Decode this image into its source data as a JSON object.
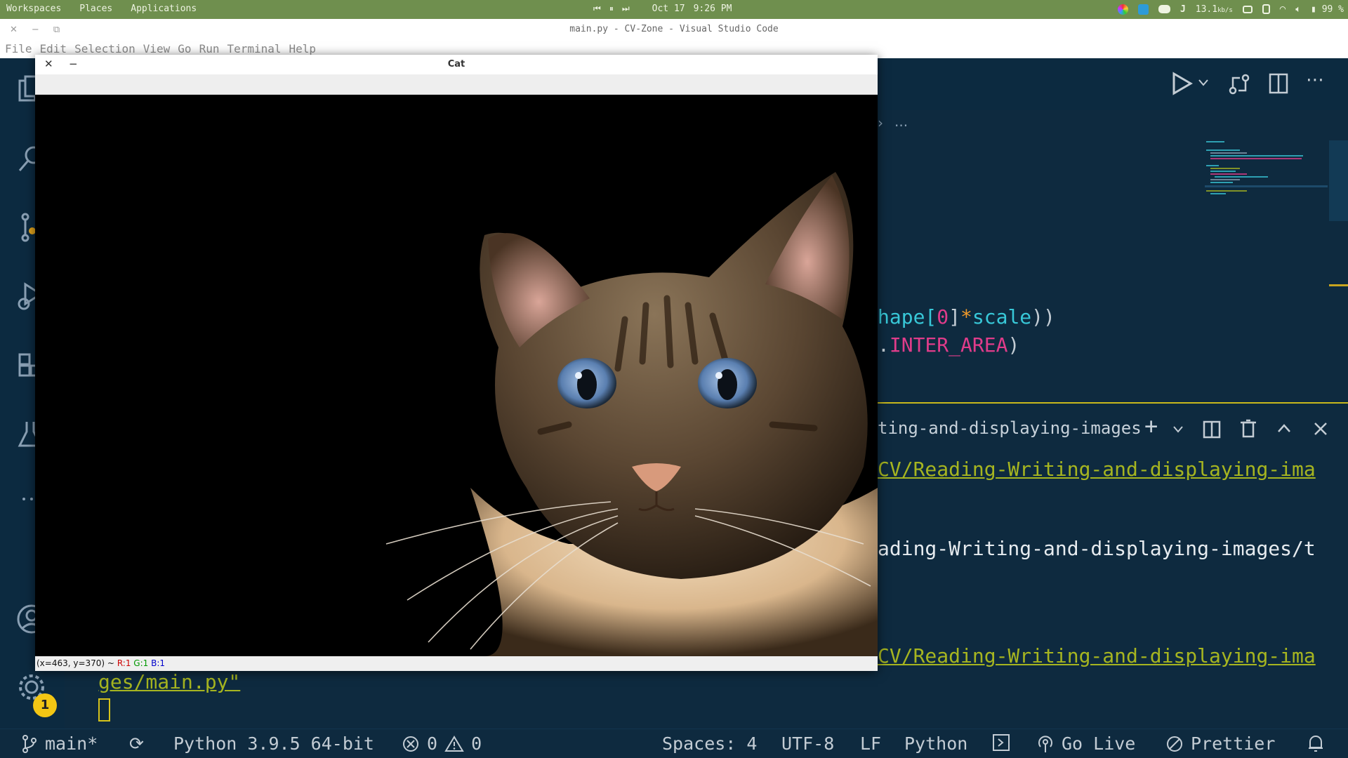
{
  "top_panel": {
    "menus": [
      "Workspaces",
      "Places",
      "Applications"
    ],
    "date": "Oct 17",
    "time": "9:26 PM",
    "net_speed": "13.1",
    "net_unit": "kb/s",
    "battery": "99 %",
    "color": "#6f8f4e"
  },
  "vscode": {
    "window_title": "main.py - CV-Zone - Visual Studio Code",
    "menu": [
      "File",
      "Edit",
      "Selection",
      "View",
      "Go",
      "Run",
      "Terminal",
      "Help"
    ],
    "breadcrumb_more": "...",
    "code_lines": {
      "line1": {
        "a": "hape[",
        "b": "0",
        "c": "]",
        "d": "*",
        "e": "scale",
        "f": "))"
      },
      "line2": {
        "a": ".",
        "b": "INTER_AREA",
        "c": ")"
      }
    },
    "panel_title": "ting-and-displaying-images",
    "terminal": {
      "line1": "CV/Reading-Writing-and-displaying-ima",
      "line2": "ading-Writing-and-displaying-images/t",
      "line3": "CV/Reading-Writing-and-displaying-ima",
      "line4": "ges/main.py\""
    },
    "settings_badge": "1",
    "status": {
      "branch": "main*",
      "python": "Python 3.9.5 64-bit",
      "errors": "0",
      "warnings": "0",
      "spaces": "Spaces: 4",
      "encoding": "UTF-8",
      "eol": "LF",
      "language": "Python",
      "golive": "Go Live",
      "prettier": "Prettier"
    },
    "colors": {
      "background": "#0e2a3f",
      "accent_yellow": "#c8b81c",
      "path_green": "#a6b520",
      "keyword_pink": "#e03c8a",
      "cyan": "#38c8d8"
    }
  },
  "cat_window": {
    "title": "Cat",
    "status": {
      "coords": "(x=463, y=370) ~",
      "r": "R:1",
      "g": "G:1",
      "b": "B:1"
    }
  }
}
